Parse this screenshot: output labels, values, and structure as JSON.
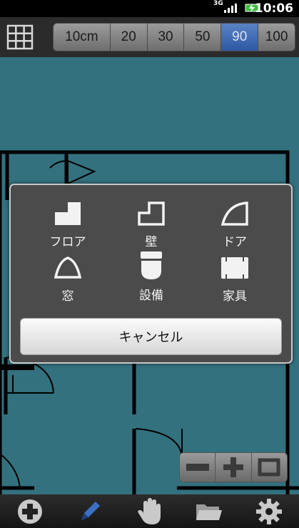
{
  "status_bar": {
    "network": "3G",
    "time": "10:06"
  },
  "toolbar": {
    "scale_options": [
      "10cm",
      "20",
      "30",
      "50",
      "90",
      "100"
    ],
    "selected_scale": "90"
  },
  "dialog": {
    "items": [
      {
        "label": "フロア",
        "icon": "floor-icon"
      },
      {
        "label": "壁",
        "icon": "wall-icon"
      },
      {
        "label": "ドア",
        "icon": "door-icon"
      },
      {
        "label": "窓",
        "icon": "window-icon"
      },
      {
        "label": "設備",
        "icon": "equipment-icon"
      },
      {
        "label": "家具",
        "icon": "furniture-icon"
      }
    ],
    "cancel_label": "キャンセル"
  },
  "zoom": {
    "icons": [
      "zoom-out-icon",
      "zoom-in-icon",
      "fit-screen-icon"
    ]
  },
  "bottom_bar": {
    "icons": [
      "add-icon",
      "pencil-icon",
      "hand-icon",
      "folder-icon",
      "gear-icon"
    ]
  },
  "colors": {
    "accent_selected": "#3a66b0",
    "grid_line": "#3f8a9a",
    "dialog_bg": "#4b4b4b"
  }
}
